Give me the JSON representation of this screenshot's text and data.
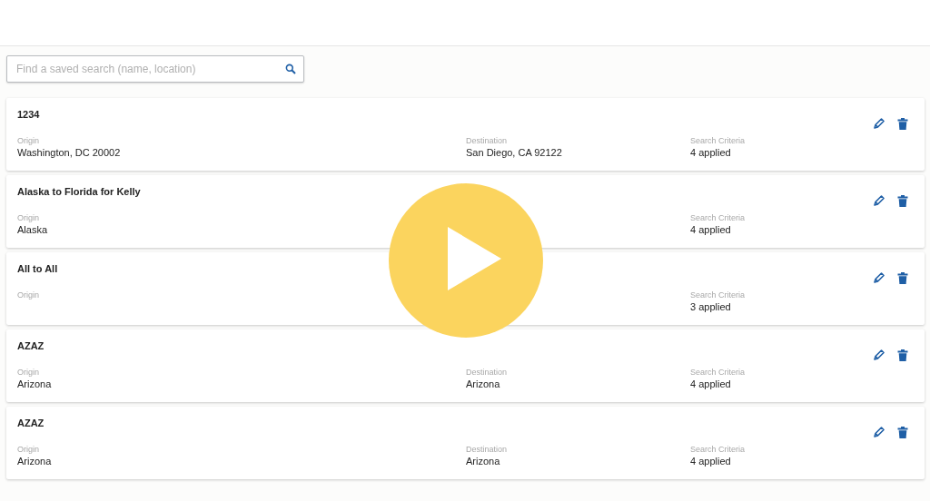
{
  "search": {
    "placeholder": "Find a saved search (name, location)"
  },
  "saved_searches": [
    {
      "name": "1234",
      "origin_label": "Origin",
      "origin": "Washington, DC 20002",
      "destination_label": "Destination",
      "destination": "San Diego, CA 92122",
      "criteria_label": "Search Criteria",
      "criteria": "4 applied"
    },
    {
      "name": "Alaska to Florida for Kelly",
      "origin_label": "Origin",
      "origin": "Alaska",
      "criteria_label": "Search Criteria",
      "criteria": "4 applied"
    },
    {
      "name": "All to All",
      "origin_label": "Origin",
      "criteria_label": "Search Criteria",
      "criteria": "3 applied"
    },
    {
      "name": "AZAZ",
      "origin_label": "Origin",
      "origin": "Arizona",
      "destination_label": "Destination",
      "destination": "Arizona",
      "criteria_label": "Search Criteria",
      "criteria": "4 applied"
    },
    {
      "name": "AZAZ",
      "origin_label": "Origin",
      "origin": "Arizona",
      "destination_label": "Destination",
      "destination": "Arizona",
      "criteria_label": "Search Criteria",
      "criteria": "4 applied"
    }
  ]
}
